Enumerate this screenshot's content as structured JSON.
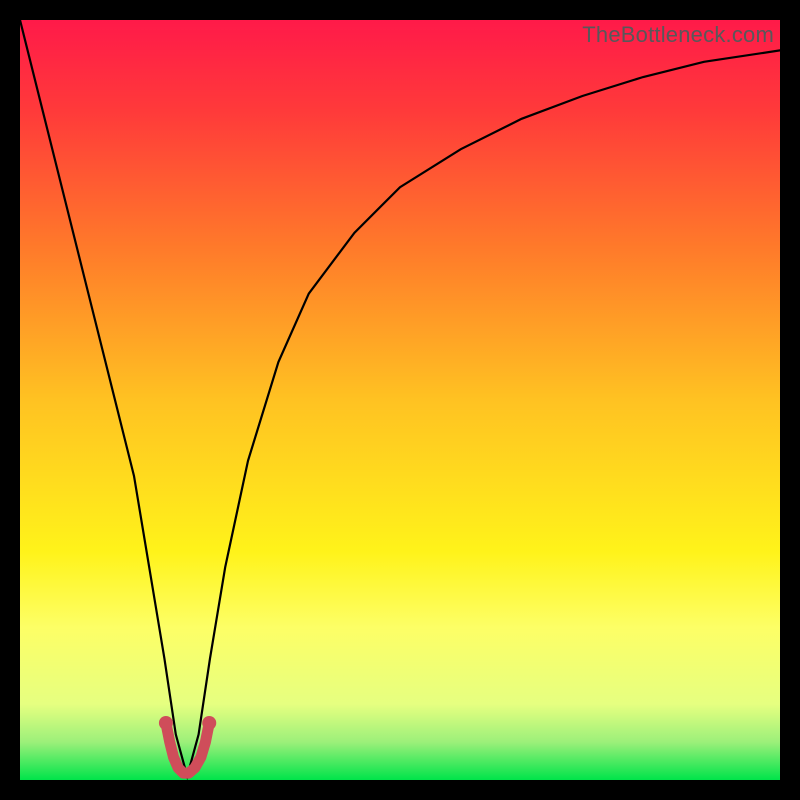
{
  "watermark": "TheBottleneck.com",
  "chart_data": {
    "type": "line",
    "title": "",
    "xlabel": "",
    "ylabel": "",
    "xlim": [
      0,
      100
    ],
    "ylim": [
      0,
      100
    ],
    "grid": false,
    "legend": false,
    "background_gradient": {
      "stops": [
        {
          "offset": 0.0,
          "color": "#ff1a49"
        },
        {
          "offset": 0.12,
          "color": "#ff3a3a"
        },
        {
          "offset": 0.3,
          "color": "#ff7a2a"
        },
        {
          "offset": 0.5,
          "color": "#ffc222"
        },
        {
          "offset": 0.7,
          "color": "#fff31a"
        },
        {
          "offset": 0.8,
          "color": "#fdff66"
        },
        {
          "offset": 0.9,
          "color": "#e6ff80"
        },
        {
          "offset": 0.95,
          "color": "#9cf07a"
        },
        {
          "offset": 1.0,
          "color": "#00e44a"
        }
      ]
    },
    "series": [
      {
        "name": "bottleneck-curve",
        "color": "#000000",
        "x": [
          0,
          3,
          6,
          9,
          12,
          15,
          17,
          19,
          20.5,
          22,
          23.5,
          25,
          27,
          30,
          34,
          38,
          44,
          50,
          58,
          66,
          74,
          82,
          90,
          100
        ],
        "y": [
          100,
          88,
          76,
          64,
          52,
          40,
          28,
          16,
          6,
          0.5,
          6,
          16,
          28,
          42,
          55,
          64,
          72,
          78,
          83,
          87,
          90,
          92.5,
          94.5,
          96
        ]
      },
      {
        "name": "optimal-marker",
        "color": "#cf4d5a",
        "marker": true,
        "x": [
          19.2,
          19.7,
          20.2,
          20.8,
          21.5,
          22.2,
          23.0,
          23.8,
          24.4,
          24.9
        ],
        "y": [
          7.5,
          5.0,
          3.0,
          1.6,
          0.9,
          0.9,
          1.6,
          3.0,
          5.0,
          7.5
        ]
      }
    ]
  }
}
